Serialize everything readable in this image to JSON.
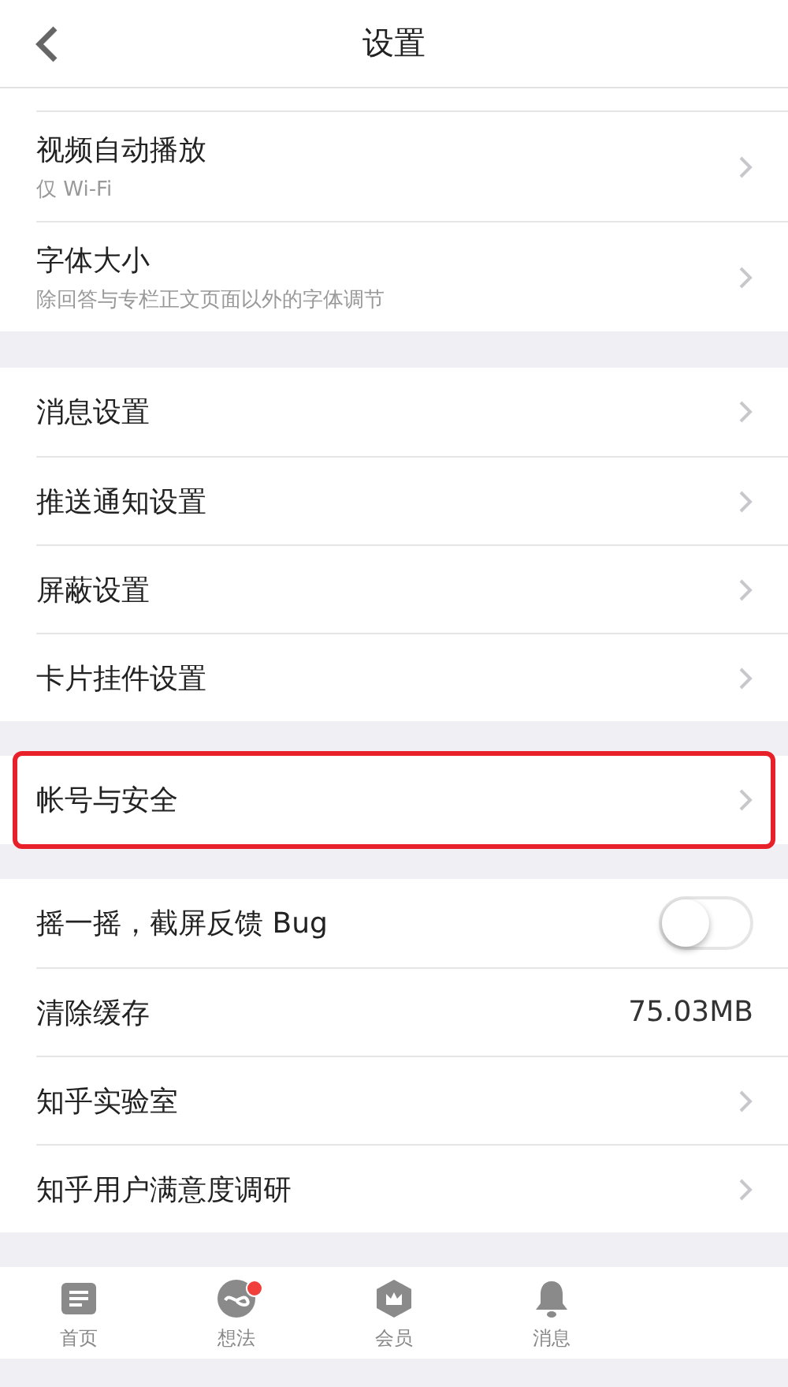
{
  "header": {
    "title": "设置"
  },
  "sections": [
    {
      "items": [
        {
          "kind": "link",
          "label": "视频自动播放",
          "subtitle": "仅 Wi-Fi",
          "highlighted": false
        },
        {
          "kind": "link",
          "label": "字体大小",
          "subtitle": "除回答与专栏正文页面以外的字体调节",
          "highlighted": false
        }
      ]
    },
    {
      "items": [
        {
          "kind": "link",
          "label": "消息设置",
          "highlighted": false
        },
        {
          "kind": "link",
          "label": "推送通知设置",
          "highlighted": false
        },
        {
          "kind": "link",
          "label": "屏蔽设置",
          "highlighted": false
        },
        {
          "kind": "link",
          "label": "卡片挂件设置",
          "highlighted": false
        }
      ]
    },
    {
      "items": [
        {
          "kind": "link",
          "label": "帐号与安全",
          "highlighted": true
        }
      ]
    },
    {
      "items": [
        {
          "kind": "toggle",
          "label": "摇一摇，截屏反馈 Bug",
          "on": false,
          "highlighted": false
        },
        {
          "kind": "value",
          "label": "清除缓存",
          "value": "75.03MB",
          "highlighted": false
        },
        {
          "kind": "link",
          "label": "知乎实验室",
          "highlighted": false
        },
        {
          "kind": "link",
          "label": "知乎用户满意度调研",
          "highlighted": false
        }
      ]
    }
  ],
  "tabs": [
    {
      "kind": "home",
      "label": "首页",
      "badge": false
    },
    {
      "kind": "ideas",
      "label": "想法",
      "badge": true
    },
    {
      "kind": "member",
      "label": "会员",
      "badge": false
    },
    {
      "kind": "messages",
      "label": "消息",
      "badge": false
    }
  ]
}
